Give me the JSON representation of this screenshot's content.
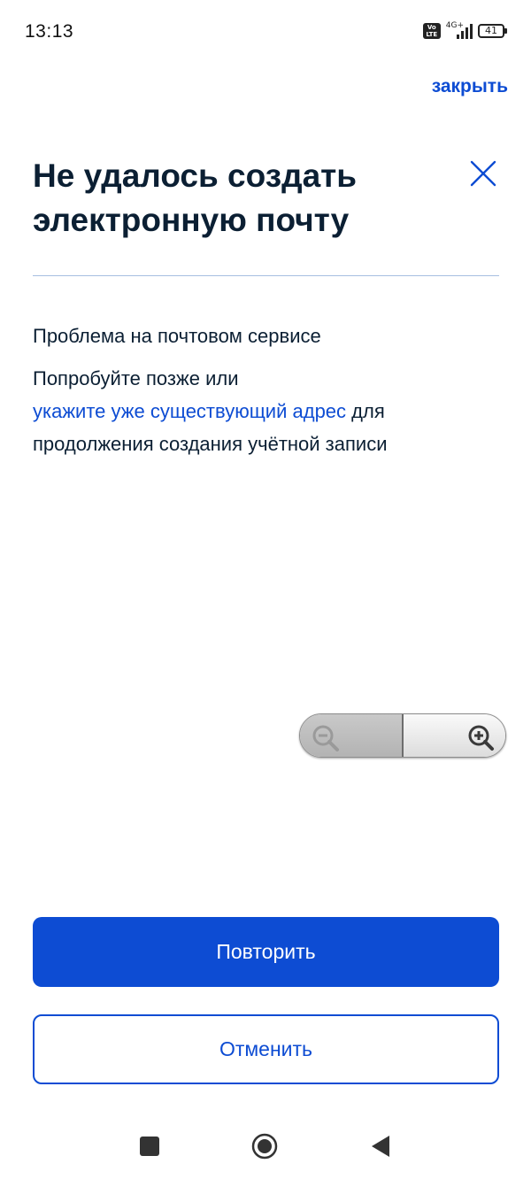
{
  "status_bar": {
    "time": "13:13",
    "volte_top": "Vo",
    "volte_bottom": "LTE",
    "network": "4G+",
    "battery": "41"
  },
  "header": {
    "close_link": "закрыть"
  },
  "dialog": {
    "title": "Не удалось создать электронную почту",
    "message_primary": "Проблема на почтовом сервисе",
    "message_prefix": "Попробуйте позже или",
    "message_link": "укажите уже существующий адрес",
    "message_suffix": " для продолжения создания учётной записи"
  },
  "actions": {
    "retry_label": "Повторить",
    "cancel_label": "Отменить"
  },
  "icons": {
    "close": "close-icon",
    "zoom_out": "zoom-out-icon",
    "zoom_in": "zoom-in-icon",
    "nav_recents": "recents-square-icon",
    "nav_home": "home-circle-icon",
    "nav_back": "back-triangle-icon"
  },
  "colors": {
    "accent": "#0d4cd3",
    "text": "#0b1f33",
    "divider": "#a7bfe0"
  }
}
